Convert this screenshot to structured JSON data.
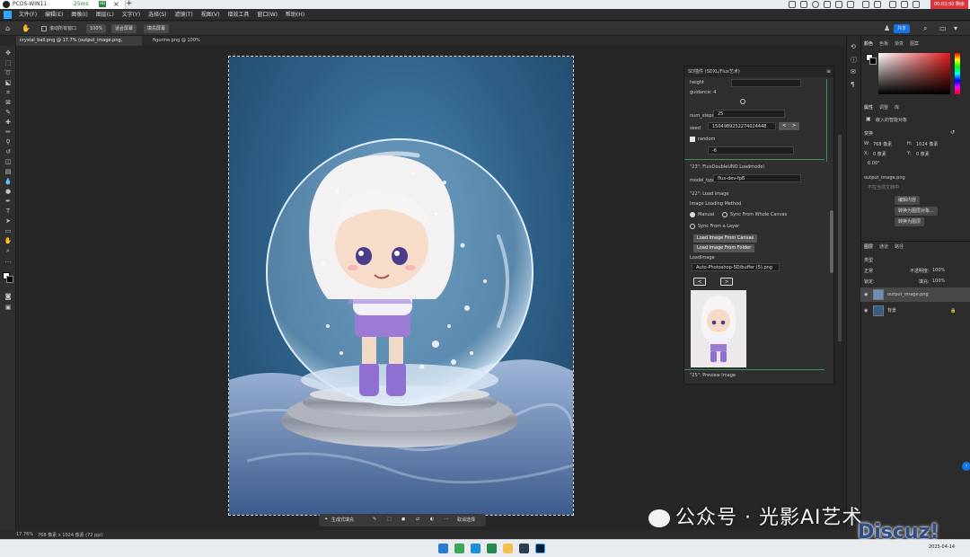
{
  "remote": {
    "window_title": "PCOS-WIN11",
    "ping": "25ms",
    "badge": "HD",
    "timer": "00:02:50 剩余"
  },
  "menu": {
    "items": [
      "文件(F)",
      "编辑(E)",
      "图像(I)",
      "图层(L)",
      "文字(Y)",
      "选择(S)",
      "滤镜(T)",
      "视图(V)",
      "增效工具",
      "窗口(W)",
      "帮助(H)"
    ]
  },
  "options": {
    "scroll_all": "滚动所有窗口",
    "zoom": "100%",
    "fit_screen": "适合屏幕",
    "fill_screen": "填充屏幕",
    "share": "共享"
  },
  "tabs": [
    {
      "label": "crystal_ball.png @ 17.7% (output_image.png, RGB/8#) *"
    },
    {
      "label": "figurine.png @ 100%(RGB/8#)"
    }
  ],
  "plugin": {
    "title": "SD插件 (SDXL/Flux艺术)",
    "height_label": "height",
    "guidance_label": "guidance: 4",
    "steps_label": "num_steps",
    "steps_value": "25",
    "seed_label": "seed",
    "seed_value": "1504989252274024448",
    "random_label": "random",
    "dropdown_value": "-6",
    "section1": "\"23\": FluxDoubleUNO Loadmodel",
    "model_label": "model_type",
    "model_value": "flux-dev-fp8",
    "section2": "\"22\": Load Image",
    "method_label": "Image Loading Method",
    "opt_manual": "Manual",
    "opt_sync_canvas": "Sync From Whole Canvas",
    "opt_sync_layer": "Sync From a Layer",
    "btn_canvas": "Load Image From Canvas",
    "btn_folder": "Load Image From Folder",
    "loadimage_label": "LoadImage",
    "loadimage_value": "Auto-Photoshop-SD/buffer (5).png",
    "prev": "<",
    "next": ">",
    "section3": "\"25\": Preview Image"
  },
  "right": {
    "tabs_top": [
      "颜色",
      "色板",
      "渐变",
      "图案"
    ],
    "tabs_props": [
      "属性",
      "调整",
      "库"
    ],
    "embedded_obj": "嵌入的智能对象",
    "transform": "变换",
    "w_label": "W:",
    "w_value": "768 像素",
    "h_label": "H:",
    "h_value": "1024 像素",
    "x_label": "X:",
    "x_value": "0 像素",
    "y_label": "Y:",
    "y_value": "0 像素",
    "angle": "0.00°",
    "file": "output_image.png",
    "file_sub": "不在当前文档中",
    "btn_edit": "编辑内容",
    "btn_convert_layers": "转换为图层对象...",
    "btn_rasterize": "转换为图层",
    "tabs_layers": [
      "图层",
      "通道",
      "路径"
    ],
    "filter_kind": "类型",
    "blend": "正常",
    "opacity_label": "不透明度:",
    "opacity": "100%",
    "lock_label": "锁定:",
    "fill_label": "填充:",
    "fill": "100%",
    "layers": [
      {
        "name": "output_image.png"
      },
      {
        "name": "背景"
      }
    ]
  },
  "context_bar": {
    "generate": "生成式填充",
    "cancel": "取消选择"
  },
  "status": {
    "zoom": "17.76%",
    "dims": "768 像素 x 1024 像素 (72 ppi)"
  },
  "taskbar": {
    "date": "2025-04-14"
  },
  "watermark": {
    "text": "公众号 · 光影AI艺术",
    "site": "Discuz!"
  },
  "colors": {
    "accent": "#31a8ff",
    "bg": "#282828",
    "panel": "#2c2c2c",
    "green": "#3f8f56"
  }
}
